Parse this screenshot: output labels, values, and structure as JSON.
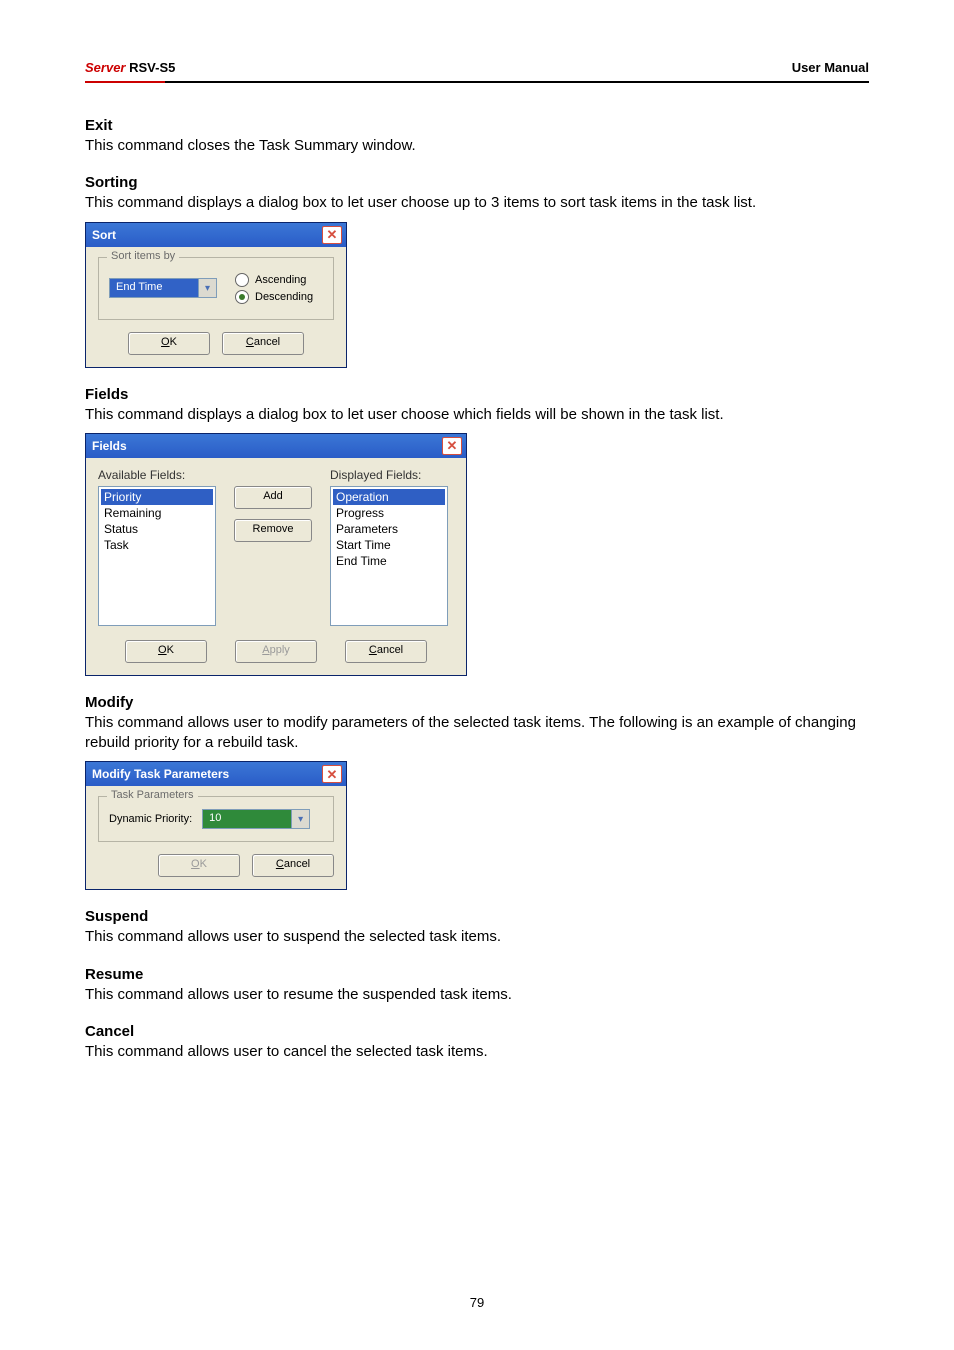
{
  "header": {
    "server_label": "Server",
    "model": "RSV-S5",
    "right": "User Manual"
  },
  "sections": {
    "exit": {
      "title": "Exit",
      "text": "This command closes the Task Summary window."
    },
    "sorting": {
      "title": "Sorting",
      "text": "This command displays a dialog box to let user choose up to 3 items to sort task items in the task list."
    },
    "fields": {
      "title": "Fields",
      "text": "This command displays a dialog box to let user choose which fields will be shown in the task list."
    },
    "modify": {
      "title": "Modify",
      "text": "This command allows user to modify parameters of the selected task items.   The following is an example of changing rebuild priority for a rebuild task."
    },
    "suspend": {
      "title": "Suspend",
      "text": "This command allows user to suspend the selected task items."
    },
    "resume": {
      "title": "Resume",
      "text": "This command allows user to resume the suspended task items."
    },
    "cancel": {
      "title": "Cancel",
      "text": "This command allows user to cancel the selected task items."
    }
  },
  "sort_dialog": {
    "title": "Sort",
    "legend": "Sort items by",
    "selected": "End Time",
    "radio_asc": "Ascending",
    "radio_desc": "Descending",
    "ok": "OK",
    "cancel": "Cancel"
  },
  "fields_dialog": {
    "title": "Fields",
    "avail_label": "Available Fields:",
    "disp_label": "Displayed Fields:",
    "available": [
      "Priority",
      "Remaining",
      "Status",
      "Task"
    ],
    "displayed": [
      "Operation",
      "Progress",
      "Parameters",
      "Start Time",
      "End Time"
    ],
    "add": "Add",
    "remove": "Remove",
    "ok": "OK",
    "apply": "Apply",
    "cancel": "Cancel"
  },
  "modify_dialog": {
    "title": "Modify Task Parameters",
    "legend": "Task Parameters",
    "label": "Dynamic Priority:",
    "value": "10",
    "ok": "OK",
    "cancel": "Cancel"
  },
  "page_number": "79"
}
